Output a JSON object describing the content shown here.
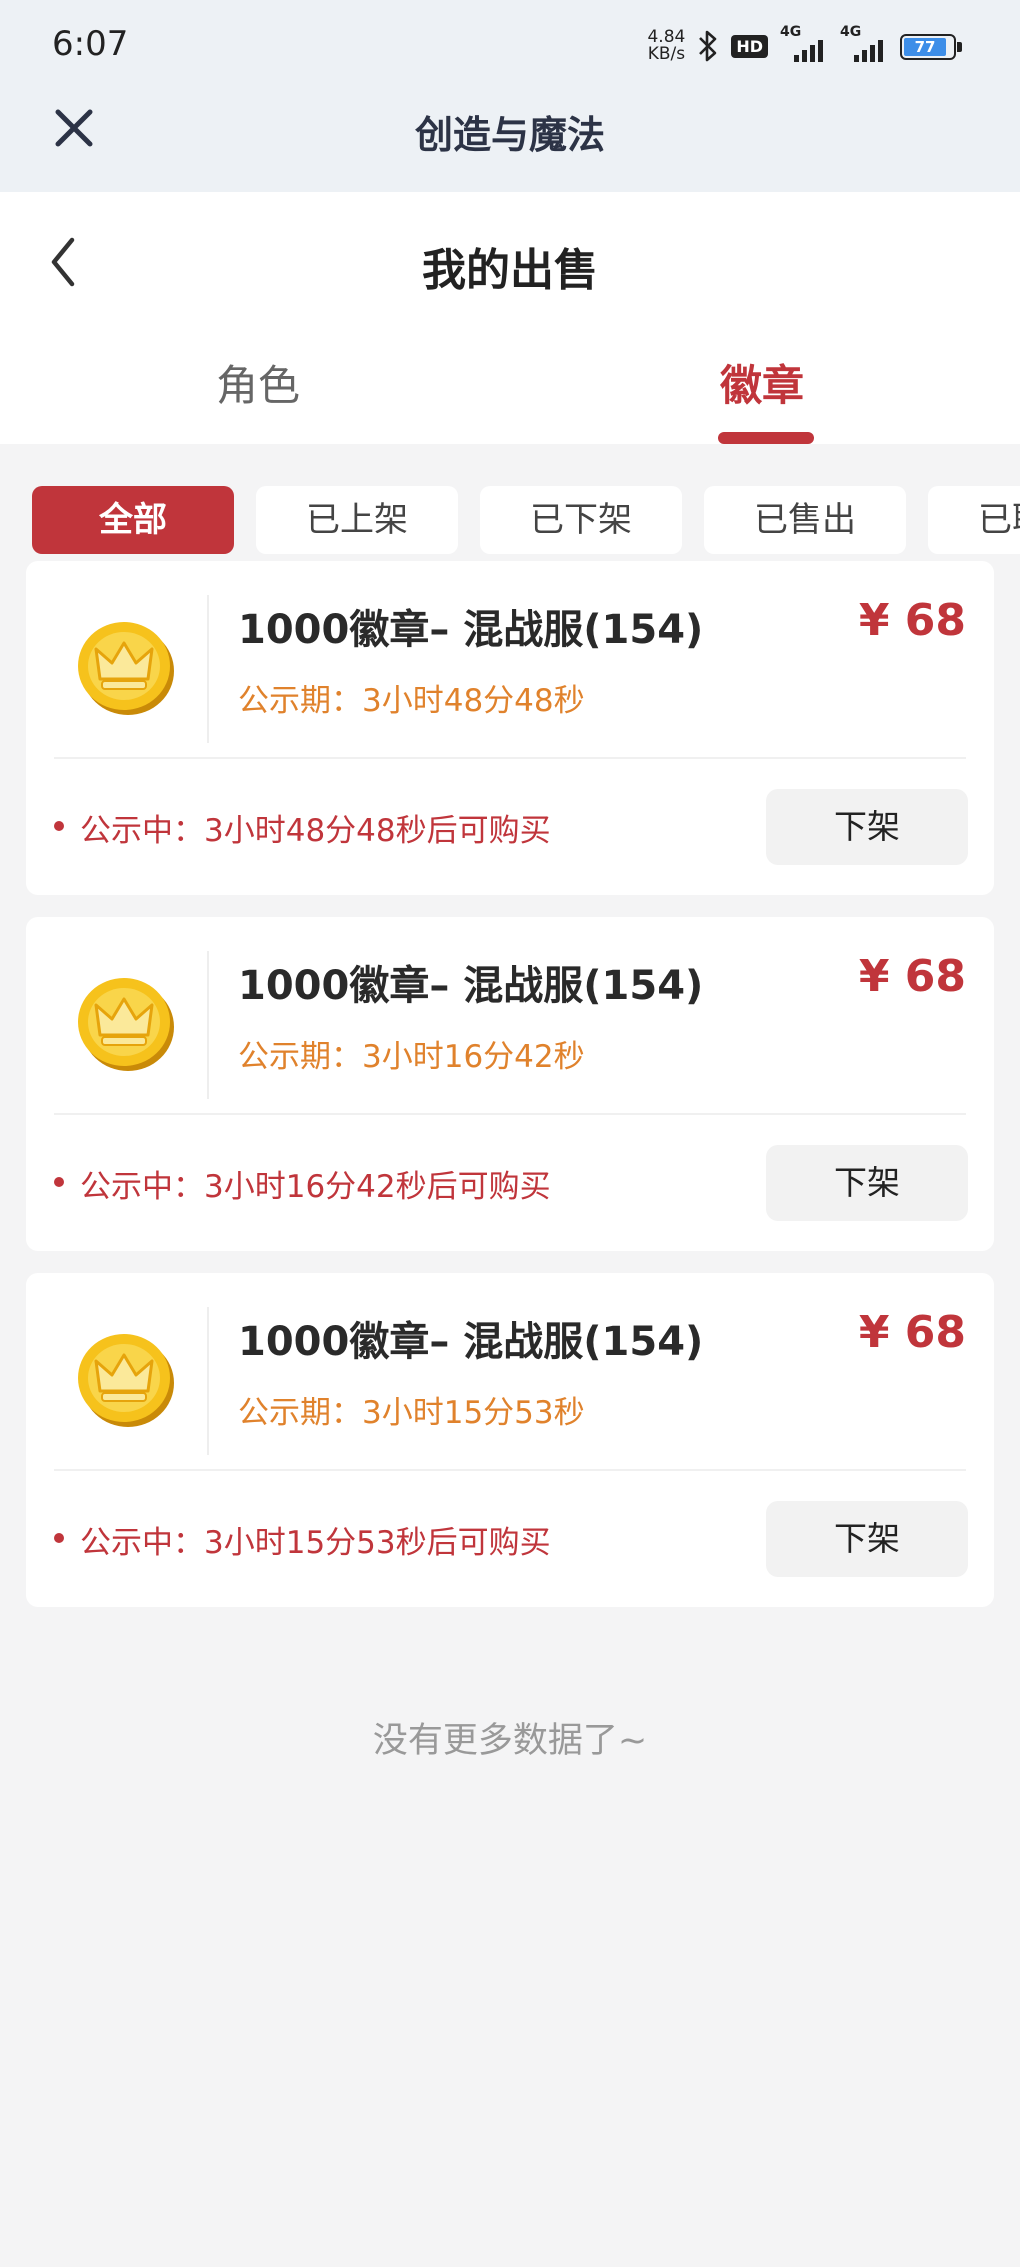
{
  "status_bar": {
    "time": "6:07",
    "net_speed_value": "4.84",
    "net_speed_unit": "KB/s",
    "hd_badge": "HD",
    "signal_1": "4G",
    "signal_2": "4G",
    "battery": "77",
    "icons": [
      "bluetooth-icon",
      "signal-icon",
      "battery-icon"
    ]
  },
  "app_bar": {
    "title": "创造与魔法",
    "close_icon": "close-icon"
  },
  "page_header": {
    "title": "我的出售",
    "back_icon": "chevron-left-icon"
  },
  "tabs": [
    {
      "label": "角色",
      "active": false
    },
    {
      "label": "徽章",
      "active": true
    }
  ],
  "filters": [
    {
      "label": "全部",
      "active": true
    },
    {
      "label": "已上架",
      "active": false
    },
    {
      "label": "已下架",
      "active": false
    },
    {
      "label": "已售出",
      "active": false
    },
    {
      "label": "已取消",
      "active": false
    }
  ],
  "listings": [
    {
      "icon": "crown-coin-icon",
      "title": "1000徽章– 混战服(154)",
      "period": "公示期：3小时48分48秒",
      "price": "¥ 68",
      "status": "公示中：3小时48分48秒后可购买",
      "button": "下架"
    },
    {
      "icon": "crown-coin-icon",
      "title": "1000徽章– 混战服(154)",
      "period": "公示期：3小时16分42秒",
      "price": "¥ 68",
      "status": "公示中：3小时16分42秒后可购买",
      "button": "下架"
    },
    {
      "icon": "crown-coin-icon",
      "title": "1000徽章– 混战服(154)",
      "period": "公示期：3小时15分53秒",
      "price": "¥ 68",
      "status": "公示中：3小时15分53秒后可购买",
      "button": "下架"
    }
  ],
  "footer": {
    "no_more": "没有更多数据了~"
  },
  "colors": {
    "accent": "#c0353b",
    "period_text": "#e0822c",
    "background": "#f4f4f5",
    "top_bar": "#edf1f5"
  }
}
